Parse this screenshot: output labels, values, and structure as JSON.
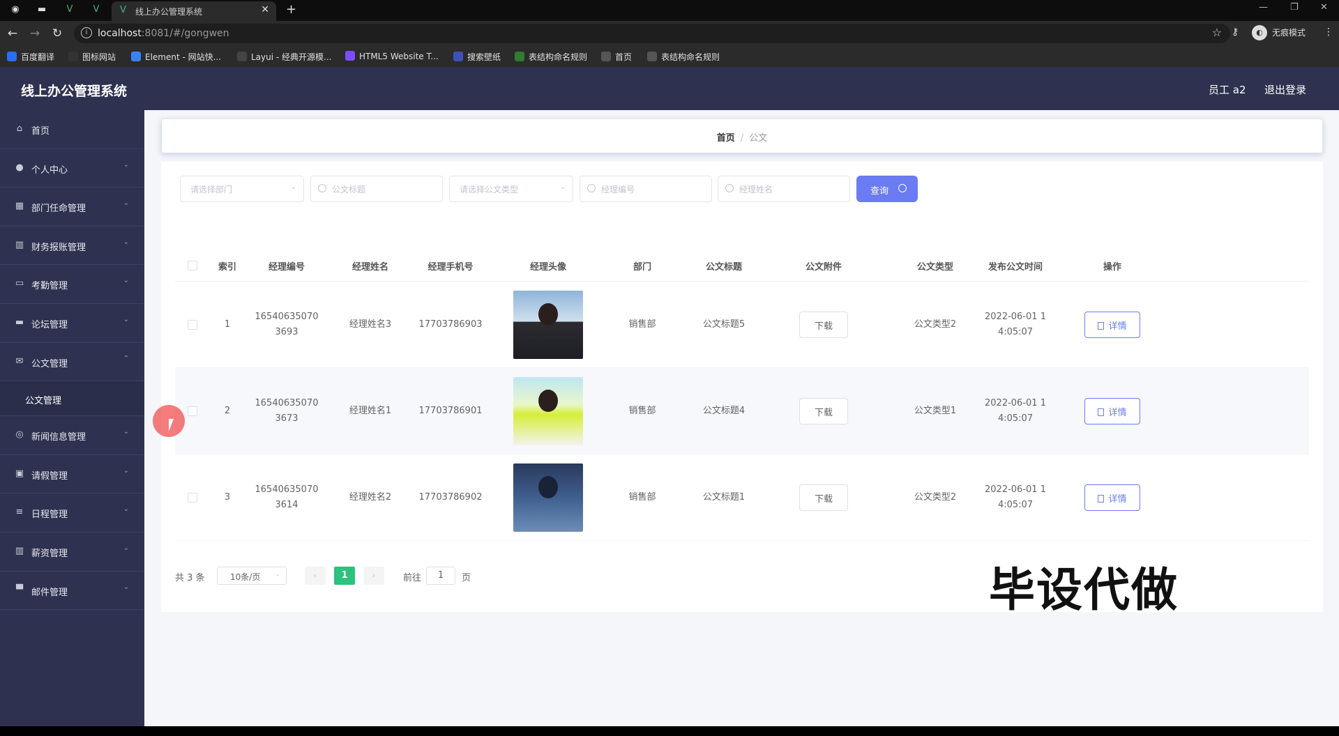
{
  "browser": {
    "tab_title": "线上办公管理系统",
    "url_host": "localhost",
    "url_rest": ":8081/#/gongwen",
    "incognito_label": "无痕模式",
    "bookmarks": [
      {
        "label": "百度翻译",
        "color": "#2a6df4"
      },
      {
        "label": "图标网站",
        "color": "#333333"
      },
      {
        "label": "Element - 网站快...",
        "color": "#3b82f6"
      },
      {
        "label": "Layui - 经典开源模...",
        "color": "#444444"
      },
      {
        "label": "HTML5 Website T...",
        "color": "#7c4dff"
      },
      {
        "label": "搜索壁纸",
        "color": "#3f51b5"
      },
      {
        "label": "表结构命名规则",
        "color": "#2e7d32"
      },
      {
        "label": "首页",
        "color": "#555555"
      },
      {
        "label": "表结构命名规则",
        "color": "#555555"
      }
    ]
  },
  "app": {
    "title": "线上办公管理系统",
    "user": "员工 a2",
    "logout": "退出登录"
  },
  "sidebar": {
    "items": [
      {
        "label": "首页",
        "icon": "home-icon",
        "glyph": "⌂",
        "arrow": ""
      },
      {
        "label": "个人中心",
        "icon": "user-icon",
        "glyph": "●",
        "arrow": "⌄"
      },
      {
        "label": "部门任命管理",
        "icon": "grid-icon",
        "glyph": "▦",
        "arrow": "⌄"
      },
      {
        "label": "财务报账管理",
        "icon": "bar-chart-icon",
        "glyph": "▥",
        "arrow": "⌄"
      },
      {
        "label": "考勤管理",
        "icon": "chat-icon",
        "glyph": "▭",
        "arrow": "⌄"
      },
      {
        "label": "论坛管理",
        "icon": "ticket-icon",
        "glyph": "▬",
        "arrow": "⌄"
      },
      {
        "label": "公文管理",
        "icon": "mail-icon",
        "glyph": "✉",
        "arrow": "⌃"
      },
      {
        "label": "新闻信息管理",
        "icon": "compass-icon",
        "glyph": "◎",
        "arrow": "⌄"
      },
      {
        "label": "请假管理",
        "icon": "message-icon",
        "glyph": "▣",
        "arrow": "⌄"
      },
      {
        "label": "日程管理",
        "icon": "list-icon",
        "glyph": "≡",
        "arrow": "⌄"
      },
      {
        "label": "薪资管理",
        "icon": "column-chart-icon",
        "glyph": "▥",
        "arrow": "⌄"
      },
      {
        "label": "邮件管理",
        "icon": "monitor-icon",
        "glyph": "▀",
        "arrow": "⌄"
      }
    ],
    "sub_item": "公文管理"
  },
  "breadcrumb": {
    "home": "首页",
    "separator": "/",
    "current": "公文"
  },
  "filters": {
    "department": "请选择部门",
    "doc_title": "公文标题",
    "doc_type": "请选择公文类型",
    "manager_no": "经理编号",
    "manager_name": "经理姓名",
    "query_label": "查询"
  },
  "table": {
    "headers": {
      "index": "索引",
      "manager_no": "经理编号",
      "manager_name": "经理姓名",
      "manager_phone": "经理手机号",
      "manager_avatar": "经理头像",
      "department": "部门",
      "doc_title": "公文标题",
      "doc_attachment": "公文附件",
      "doc_type": "公文类型",
      "publish_time": "发布公文时间",
      "actions": "操作"
    },
    "rows": [
      {
        "index": "1",
        "no_line1": "16540635070",
        "no_line2": "3693",
        "name": "经理姓名3",
        "phone": "17703786903",
        "department": "销售部",
        "title": "公文标题5",
        "download": "下载",
        "type": "公文类型2",
        "time_line1": "2022-06-01 1",
        "time_line2": "4:05:07",
        "detail": "详情"
      },
      {
        "index": "2",
        "no_line1": "16540635070",
        "no_line2": "3673",
        "name": "经理姓名1",
        "phone": "17703786901",
        "department": "销售部",
        "title": "公文标题4",
        "download": "下载",
        "type": "公文类型1",
        "time_line1": "2022-06-01 1",
        "time_line2": "4:05:07",
        "detail": "详情"
      },
      {
        "index": "3",
        "no_line1": "16540635070",
        "no_line2": "3614",
        "name": "经理姓名2",
        "phone": "17703786902",
        "department": "销售部",
        "title": "公文标题1",
        "download": "下载",
        "type": "公文类型2",
        "time_line1": "2022-06-01 1",
        "time_line2": "4:05:07",
        "detail": "详情"
      }
    ]
  },
  "pagination": {
    "total": "共 3 条",
    "page_size": "10条/页",
    "prev": "‹",
    "current": "1",
    "next": "›",
    "goto_label": "前往",
    "goto_value": "1",
    "goto_unit": "页"
  },
  "watermark": "毕设代做"
}
